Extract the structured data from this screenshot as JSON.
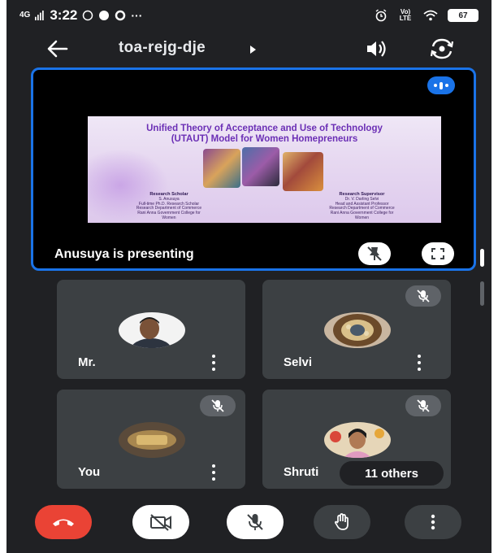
{
  "status_bar": {
    "signal_label": "4G",
    "time": "3:22",
    "network_label": "Vo) LTE",
    "battery": "67"
  },
  "header": {
    "meeting_code": "toa-rejg-dje"
  },
  "presentation": {
    "slide": {
      "title_line1": "Unified Theory of Acceptance and Use of Technology",
      "title_line2": "(UTAUT) Model for Women Homepreneurs",
      "scholar": {
        "heading": "Research Scholar",
        "lines": [
          "S. Anusuya",
          "Full-time Ph.D. Research Scholar",
          "Research Department of Commerce",
          "Rani Anna Government College for",
          "Women"
        ]
      },
      "supervisor": {
        "heading": "Research Supervisor",
        "lines": [
          "Dr. V. Darling Selvi",
          "Head and Assistant Professor",
          "Research Department of Commerce",
          "Rani Anna Government College for",
          "Women"
        ]
      }
    },
    "presenting_label": "Anusuya is presenting"
  },
  "participants": [
    {
      "name": "Mr.",
      "muted": false
    },
    {
      "name": "Selvi",
      "muted": true
    },
    {
      "name": "You",
      "muted": true
    },
    {
      "name": "Shruti",
      "muted": true,
      "others_label": "11 others"
    }
  ],
  "icons": {
    "back": "arrow-left-icon",
    "caret": "caret-right-icon",
    "speaker": "speaker-icon",
    "switch_camera": "switch-camera-icon",
    "hangup": "phone-hangup-icon",
    "camera_off": "camera-off-icon",
    "mic_off": "mic-off-icon",
    "raise_hand": "hand-icon",
    "more": "more-vertical-icon"
  },
  "colors": {
    "background": "#202124",
    "tile": "#3c4043",
    "accent": "#1a73e8",
    "hangup": "#ea4335"
  }
}
